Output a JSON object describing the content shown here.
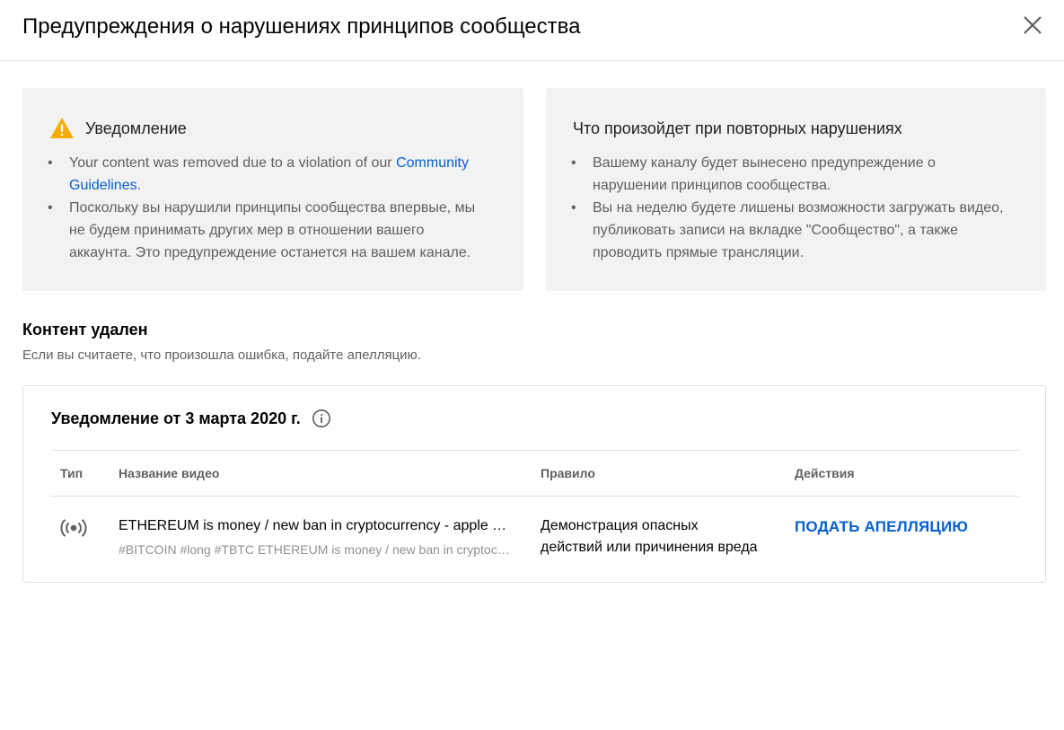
{
  "dialog": {
    "title": "Предупреждения о нарушениях принципов сообщества"
  },
  "notice_card": {
    "heading": "Уведомление",
    "item1_prefix": "Your content was removed due to a violation of our ",
    "item1_link_a": "Community",
    "item1_link_b": "Guidelines",
    "item1_suffix": ".",
    "item2_line1": "Поскольку вы нарушили принципы сообщества впервые, мы",
    "item2_line2": "не будем принимать других мер в отношении вашего",
    "item2_line3": "аккаунта. Это предупреждение останется на вашем канале."
  },
  "repeat_card": {
    "heading": "Что произойдет при повторных нарушениях",
    "item1_line1": "Вашему каналу будет вынесено предупреждение о",
    "item1_line2": "нарушении принципов сообщества.",
    "item2_line1": "Вы на неделю будете лишены возможности загружать видео,",
    "item2_line2": "публиковать записи на вкладке \"Сообщество\", а также",
    "item2_line3": "проводить прямые трансляции."
  },
  "content_section": {
    "title": "Контент удален",
    "subtitle": "Если вы считаете, что произошла ошибка, подайте апелляцию."
  },
  "notice_table": {
    "title": "Уведомление от 3 марта 2020 г.",
    "columns": {
      "type": "Тип",
      "name": "Название видео",
      "rule": "Правило",
      "actions": "Действия"
    },
    "rows": [
      {
        "type_icon": "live-stream-icon",
        "video_title": "ETHEREUM is money / new ban in cryptocurrency - apple and ETHEREUM",
        "video_description": "#BITCOIN #long #TBTC ETHEREUM is money / new ban in cryptocurrency",
        "rule_line1": "Демонстрация опасных",
        "rule_line2": "действий или причинения вреда",
        "action_label": "ПОДАТЬ АПЕЛЛЯЦИЮ"
      }
    ]
  },
  "colors": {
    "link": "#065fd4",
    "warning": "#f9ab00",
    "card_bg": "#f2f2f2"
  }
}
